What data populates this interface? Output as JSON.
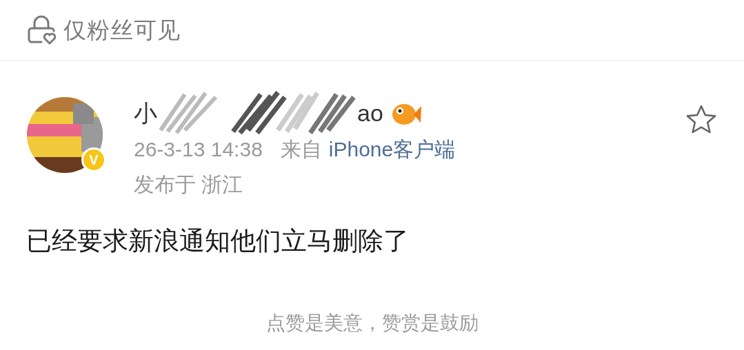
{
  "header": {
    "label": "仅粉丝可见"
  },
  "post": {
    "name_start": "小",
    "name_end": "ao",
    "verified_badge": "V",
    "time": "26-3-13 14:38",
    "source_prefix": "来自",
    "source": "iPhone客户端",
    "location": "发布于 浙江",
    "favorited": false,
    "text": "已经要求新浪通知他们立马删除了"
  },
  "footer": {
    "text": "点赞是美意，赞赏是鼓励"
  }
}
